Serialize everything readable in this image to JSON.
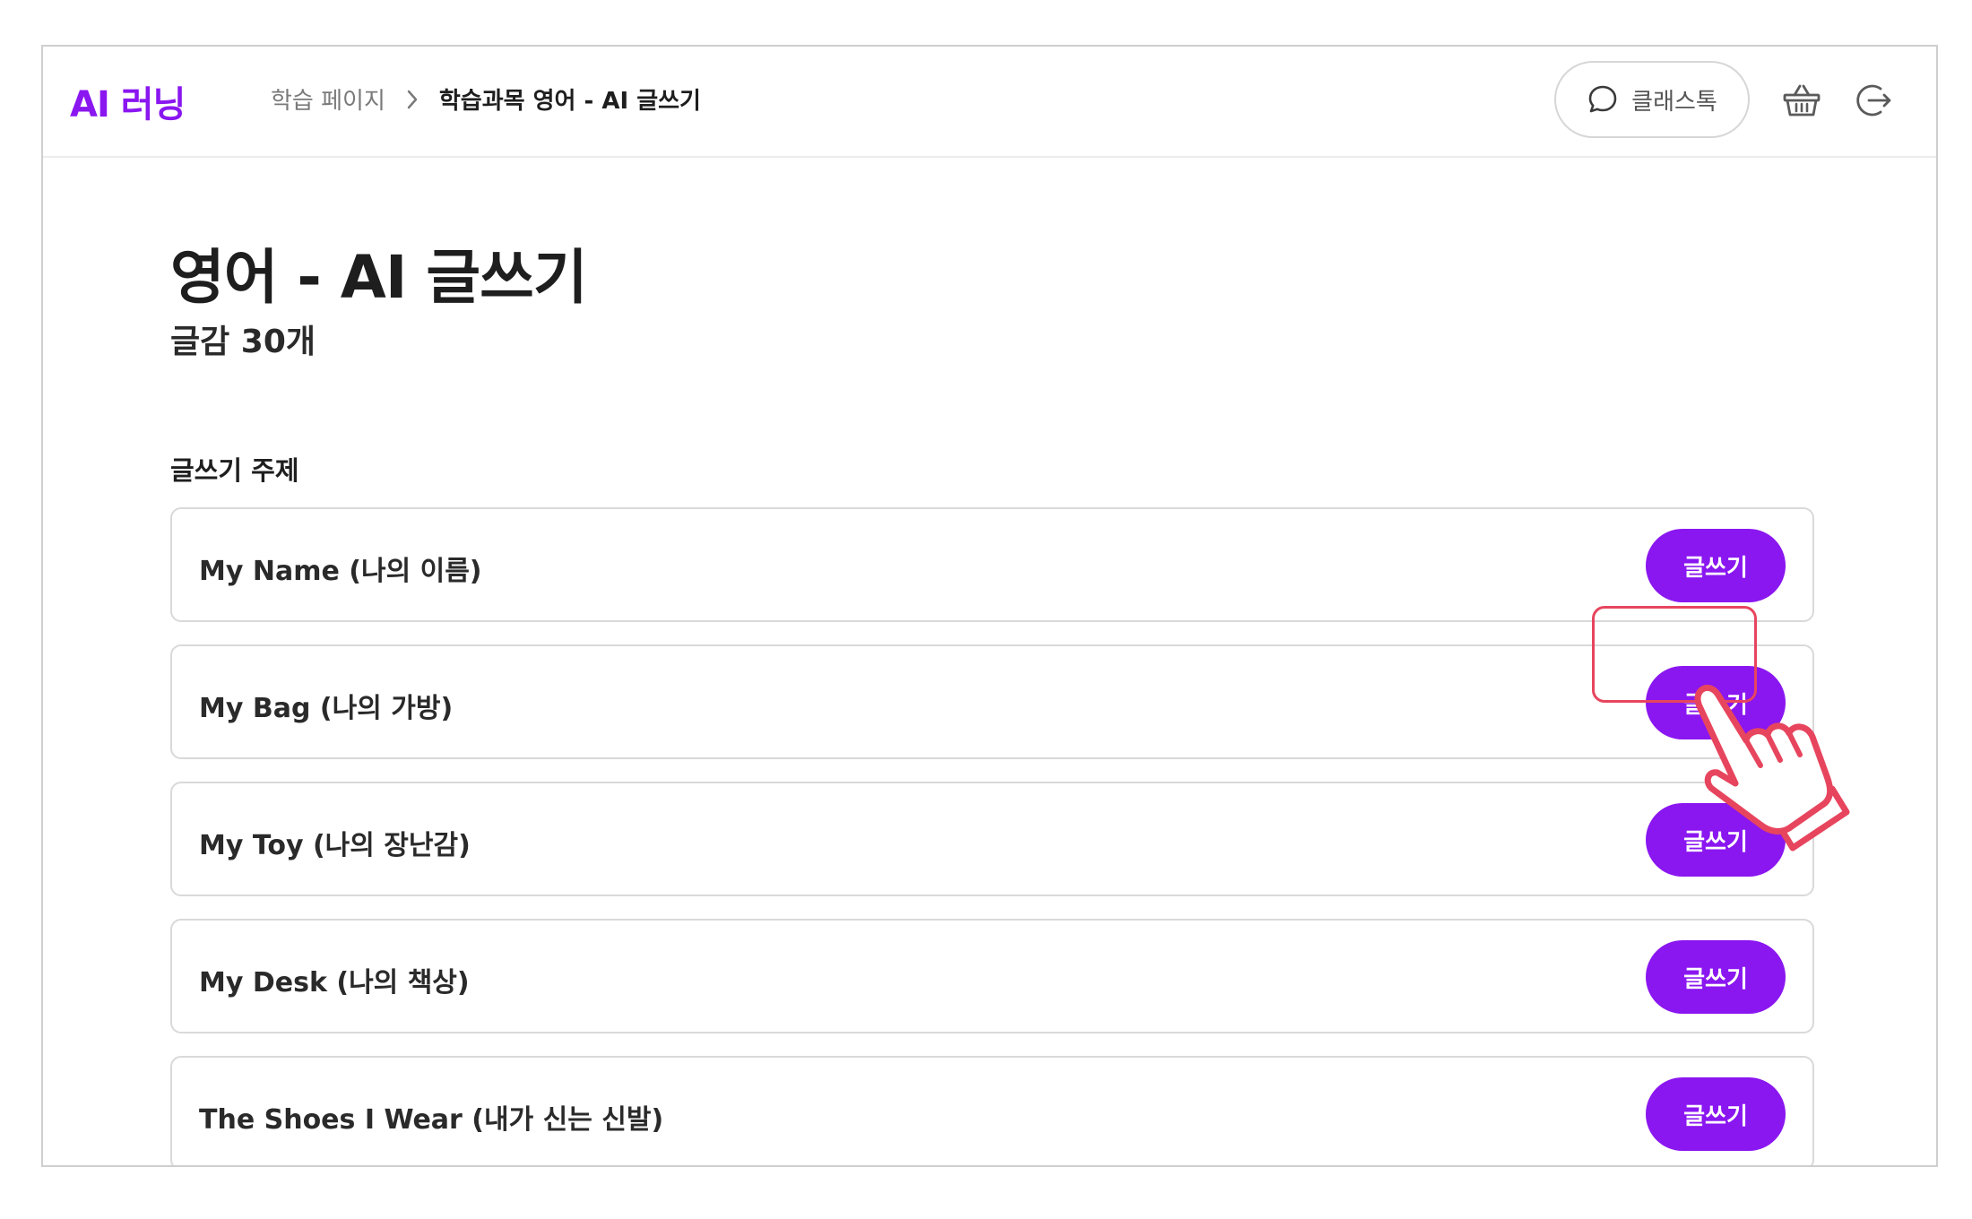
{
  "header": {
    "logo": "AI 러닝",
    "breadcrumb": {
      "first": "학습 페이지",
      "current": "학습과목 영어 - AI 글쓰기"
    },
    "chat_label": "클래스톡",
    "icons": {
      "chat": "chat-bubble-icon",
      "basket": "basket-icon",
      "logout": "logout-icon",
      "separator": "chevron-right-icon"
    }
  },
  "main": {
    "title": "영어 - AI 글쓰기",
    "subtitle": "글감 30개",
    "section_title": "글쓰기 주제",
    "topics": [
      {
        "title": "My Name (나의 이름)",
        "button": "글쓰기"
      },
      {
        "title": "My Bag (나의 가방)",
        "button": "글쓰기"
      },
      {
        "title": "My Toy (나의 장난감)",
        "button": "글쓰기"
      },
      {
        "title": "My Desk (나의 책상)",
        "button": "글쓰기"
      },
      {
        "title": "The Shoes I Wear (내가 신는 신발)",
        "button": "글쓰기"
      }
    ]
  },
  "annotation": {
    "pointer_icon": "hand-pointer-icon",
    "highlighted_topic": "My Bag (나의 가방)"
  },
  "colors": {
    "accent": "#8a16f0",
    "highlight": "#e7455e",
    "text": "#1e1e1e",
    "border": "#d9d9d9"
  }
}
